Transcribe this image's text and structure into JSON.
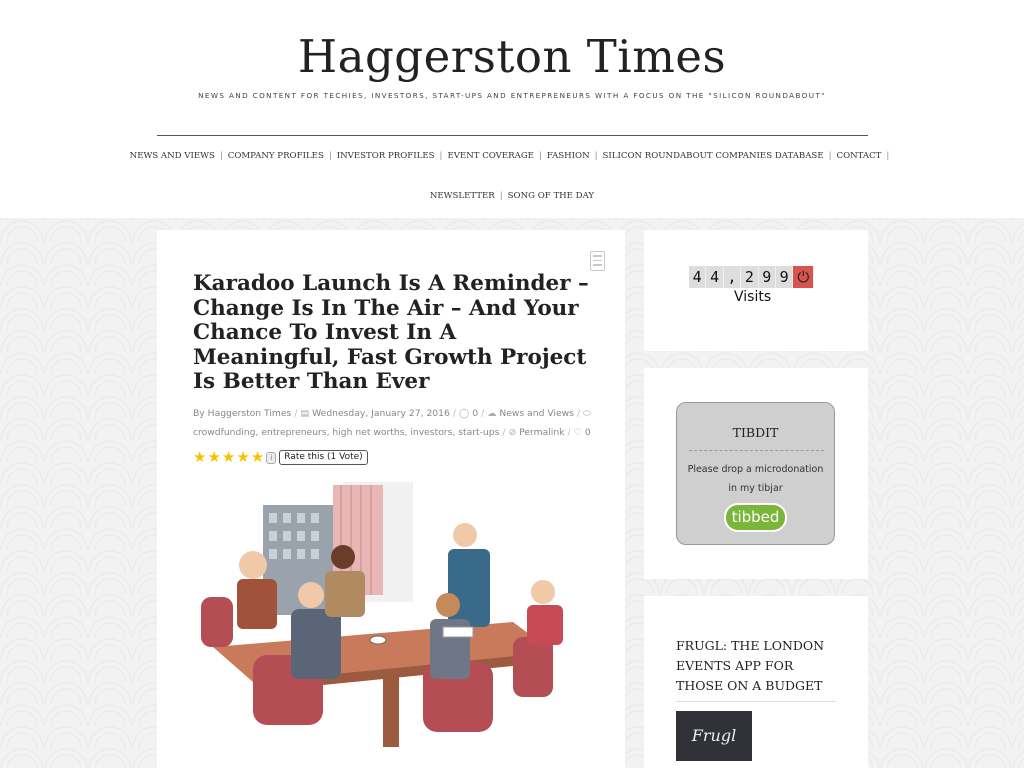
{
  "site": {
    "title": "Haggerston Times",
    "tagline": "NEWS AND CONTENT FOR TECHIES, INVESTORS, START-UPS AND ENTREPRENEURS WITH A FOCUS ON THE \"SILICON ROUNDABOUT\""
  },
  "nav": {
    "items": [
      {
        "label": "NEWS AND VIEWS"
      },
      {
        "label": "COMPANY PROFILES"
      },
      {
        "label": "INVESTOR PROFILES"
      },
      {
        "label": "EVENT COVERAGE"
      },
      {
        "label": "FASHION"
      },
      {
        "label": "SILICON ROUNDABOUT COMPANIES DATABASE"
      },
      {
        "label": "CONTACT"
      },
      {
        "label": "NEWSLETTER"
      },
      {
        "label": "SONG OF THE DAY"
      }
    ],
    "separator": "|"
  },
  "post": {
    "title": "Karadoo Launch Is A Reminder – Change Is In The Air – And Your Chance To Invest In A Meaningful, Fast Growth Project Is Better Than Ever",
    "author": "By Haggerston Times",
    "date": "Wednesday, January 27, 2016",
    "comments": "0",
    "category": "News and Views",
    "tags": "crowdfunding, entrepreneurs, high net worths, investors, start-ups",
    "permalink": "Permalink",
    "likes": "0",
    "rating": {
      "stars": 5,
      "button_label": "Rate this (1 Vote)",
      "info_glyph": "i"
    },
    "format_icon": "document-icon",
    "image_icon": "boardroom-cartoon"
  },
  "sidebar": {
    "counter": {
      "digits": [
        "4",
        "4",
        ",",
        "2",
        "9",
        "9"
      ],
      "plug_icon": "plug-icon",
      "label": "Visits"
    },
    "tibdit": {
      "title": "TIBDIT",
      "text_line1": "Please drop a microdonation",
      "text_line2": "in my tibjar",
      "button": "tibbed",
      "button_color": "#79b63a"
    },
    "frugl": {
      "title": "FRUGL: THE LONDON EVENTS APP FOR THOSE ON A BUDGET",
      "logo_text": "Frugl"
    }
  },
  "colors": {
    "star": "#f5c400",
    "counter_plug": "#d9534f"
  }
}
